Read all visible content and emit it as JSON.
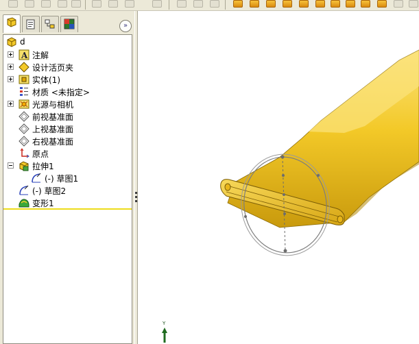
{
  "toolbar": {
    "left_icons": [
      "hidden-line-icon",
      "rotate-icon",
      "zoom-icon",
      "pan-icon",
      "select-icon"
    ],
    "right_icons": [
      "view-front-icon",
      "view-back-icon",
      "view-left-icon",
      "view-right-icon",
      "view-top-icon",
      "view-bottom-icon",
      "view-iso-icon",
      "shaded-icon",
      "hlr-icon",
      "edges-icon",
      "wireframe-icon"
    ]
  },
  "panel": {
    "tabs": [
      "feature-manager",
      "property-manager",
      "configuration-manager",
      "display-manager"
    ],
    "collapse_glyph": "»"
  },
  "tree": {
    "root": {
      "label": "d",
      "icon": "part-icon"
    },
    "items": [
      {
        "label": "注解",
        "icon": "annotations-icon",
        "expander": "+"
      },
      {
        "label": "设计活页夹",
        "icon": "design-binder-icon",
        "expander": "+"
      },
      {
        "label": "实体(1)",
        "icon": "solid-bodies-icon",
        "expander": "+"
      },
      {
        "label": "材质 <未指定>",
        "icon": "material-icon",
        "expander": ""
      },
      {
        "label": "光源与相机",
        "icon": "lights-cameras-icon",
        "expander": "+"
      },
      {
        "label": "前视基准面",
        "icon": "plane-icon",
        "expander": ""
      },
      {
        "label": "上视基准面",
        "icon": "plane-icon",
        "expander": ""
      },
      {
        "label": "右视基准面",
        "icon": "plane-icon",
        "expander": ""
      },
      {
        "label": "原点",
        "icon": "origin-icon",
        "expander": ""
      },
      {
        "label": "拉伸1",
        "icon": "extrude-icon",
        "expander": "-"
      },
      {
        "label": "(-) 草图1",
        "icon": "sketch-icon",
        "expander": ""
      },
      {
        "label": "(-) 草图2",
        "icon": "sketch-icon",
        "expander": ""
      },
      {
        "label": "变形1",
        "icon": "deform-icon",
        "expander": ""
      }
    ]
  },
  "viewport": {
    "axis_y_label": "Y",
    "model_color": "#f3c928"
  }
}
